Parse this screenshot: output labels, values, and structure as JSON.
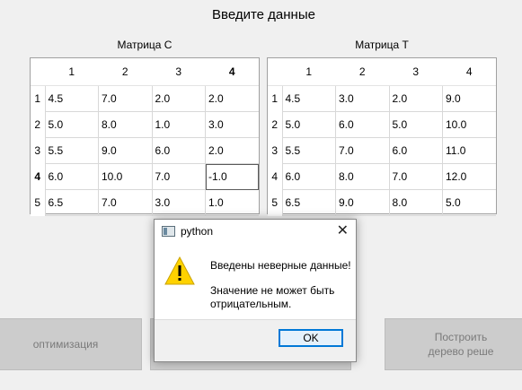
{
  "header": {
    "title": "Введите данные"
  },
  "matrix_c": {
    "label": "Матрица С",
    "columns": [
      "1",
      "2",
      "3",
      "4"
    ],
    "row_headers": [
      "1",
      "2",
      "3",
      "4",
      "5"
    ],
    "rows": [
      [
        "4.5",
        "7.0",
        "2.0",
        "2.0"
      ],
      [
        "5.0",
        "8.0",
        "1.0",
        "3.0"
      ],
      [
        "5.5",
        "9.0",
        "6.0",
        "2.0"
      ],
      [
        "6.0",
        "10.0",
        "7.0",
        "-1.0"
      ],
      [
        "6.5",
        "7.0",
        "3.0",
        "1.0"
      ]
    ]
  },
  "matrix_t": {
    "label": "Матрица Т",
    "columns": [
      "1",
      "2",
      "3",
      "4"
    ],
    "row_headers": [
      "1",
      "2",
      "3",
      "4",
      "5"
    ],
    "rows": [
      [
        "4.5",
        "3.0",
        "2.0",
        "9.0"
      ],
      [
        "5.0",
        "6.0",
        "5.0",
        "10.0"
      ],
      [
        "5.5",
        "7.0",
        "6.0",
        "11.0"
      ],
      [
        "6.0",
        "8.0",
        "7.0",
        "12.0"
      ],
      [
        "6.5",
        "9.0",
        "8.0",
        "5.0"
      ]
    ]
  },
  "buttons": {
    "optimization": "оптимизация",
    "middle": "",
    "build_tree_line1": "Построить",
    "build_tree_line2": "дерево реше"
  },
  "dialog": {
    "title": "python",
    "close_glyph": "✕",
    "message_main": "Введены неверные данные!",
    "message_detail": "Значение не может быть отрицательным.",
    "ok_label": "OK",
    "icon": "warning-icon"
  },
  "colors": {
    "dialog_accent": "#0078d7",
    "warning_fill": "#ffd200"
  }
}
